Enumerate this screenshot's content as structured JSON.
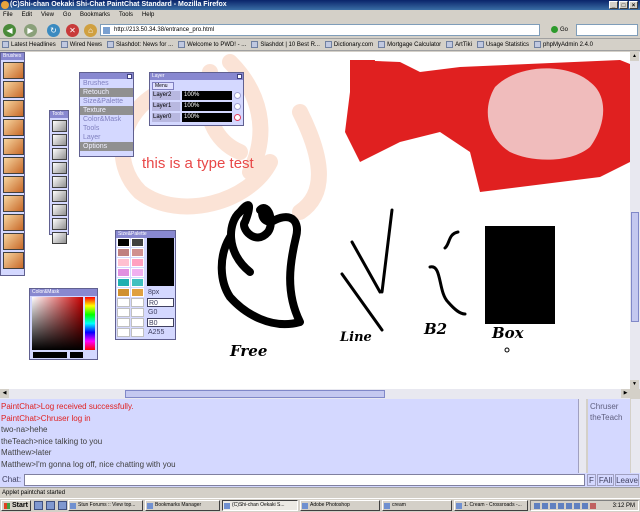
{
  "window": {
    "title": "(C)Shi-chan Oekaki Shi-Chat PaintChat Standard - Mozilla Firefox",
    "buttons": [
      "_",
      "□",
      "×"
    ]
  },
  "menubar": [
    "File",
    "Edit",
    "View",
    "Go",
    "Bookmarks",
    "Tools",
    "Help"
  ],
  "nav": {
    "url": "http://213.50.34.38/entrance_pro.html",
    "go_label": "Go"
  },
  "bookmarks": [
    "Latest Headlines",
    "Wired News",
    "Slashdot: News for ...",
    "Welcome to PWD! - ...",
    "Slashdot | 10 Best R...",
    "Dictionary.com",
    "Mortgage Calculator",
    "ArtTiki",
    "Usage Statistics",
    "phpMyAdmin 2.4.0"
  ],
  "paintchat": {
    "menu_palette": {
      "items": [
        "Brushes",
        "Retouch",
        "Size&Palette",
        "Texture",
        "Color&Mask",
        "Tools",
        "Layer",
        "Options"
      ],
      "selected": [
        "Retouch",
        "Texture",
        "Options"
      ]
    },
    "layer_palette": {
      "title": "Layer",
      "menu_label": "Menu",
      "layers": [
        {
          "name": "Layer2",
          "opacity": "100%"
        },
        {
          "name": "Layer1",
          "opacity": "100%"
        },
        {
          "name": "Layer0",
          "opacity": "100%"
        }
      ]
    },
    "size_palette": {
      "title": "Size&Palette",
      "size_label": "8px",
      "r": "R0",
      "g": "G0",
      "b": "B0",
      "a": "A255"
    },
    "colormask_palette": {
      "title": "Color&Mask"
    },
    "tools_palette_title": "Tools",
    "brushes_palette_title": "Brushes",
    "canvas": {
      "type_text": "this is a type test",
      "labels": [
        "Free",
        "Line",
        "B2",
        "Box"
      ]
    },
    "colors": {
      "palette_bg": "#d4d8ff",
      "accent_red": "#e02020",
      "type_text": "#e84848"
    }
  },
  "chat": {
    "messages": [
      {
        "text": "PaintChat>Log received successfully.",
        "system": true
      },
      {
        "text": "PaintChat>Chruser log in",
        "system": true
      },
      {
        "text": "two-na>hehe",
        "system": false
      },
      {
        "text": "theTeach>nice talking to you",
        "system": false
      },
      {
        "text": "Matthew>later",
        "system": false
      },
      {
        "text": "Matthew>I'm gonna log off, nice chatting with you",
        "system": false
      }
    ],
    "users": [
      "Chruser",
      "theTeach"
    ],
    "label": "Chat:",
    "buttons": {
      "f": "F",
      "fall": "FAll",
      "leave": "Leave"
    }
  },
  "status": "Applet paintchat started",
  "taskbar": {
    "start": "Start",
    "tasks": [
      "Stun Forums :: View top...",
      "Bookmarks Manager",
      "(C)Shi-chan Oekaki S...",
      "Adobe Photoshop",
      "cream",
      "1. Cream - Crossroads -..."
    ],
    "active_task": "(C)Shi-chan Oekaki S...",
    "clock": "3:12 PM"
  }
}
